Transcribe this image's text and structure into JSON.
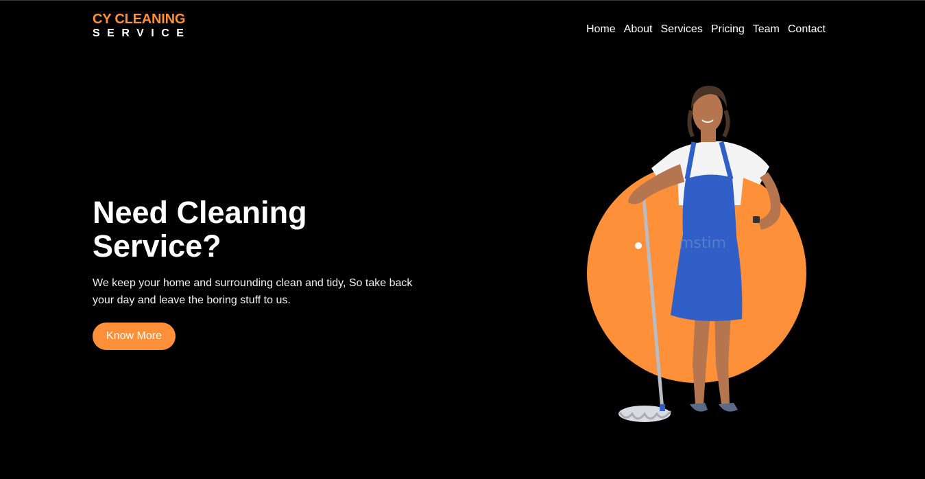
{
  "colors": {
    "accent": "#fd9039",
    "background": "#000000",
    "text": "#ffffff",
    "apron": "#2f5fc7"
  },
  "brand": {
    "name_top": "CY CLEANING",
    "name_bottom": "SERVICE"
  },
  "nav": {
    "items": [
      "Home",
      "About",
      "Services",
      "Pricing",
      "Team",
      "Contact"
    ]
  },
  "hero": {
    "title": "Need Cleaning Service?",
    "description": "We keep your home and surrounding clean and tidy, So take back your day and leave the boring stuff to us.",
    "cta_label": "Know More"
  },
  "illustration": {
    "subject": "cleaner-with-mop",
    "watermark": "mstim"
  }
}
